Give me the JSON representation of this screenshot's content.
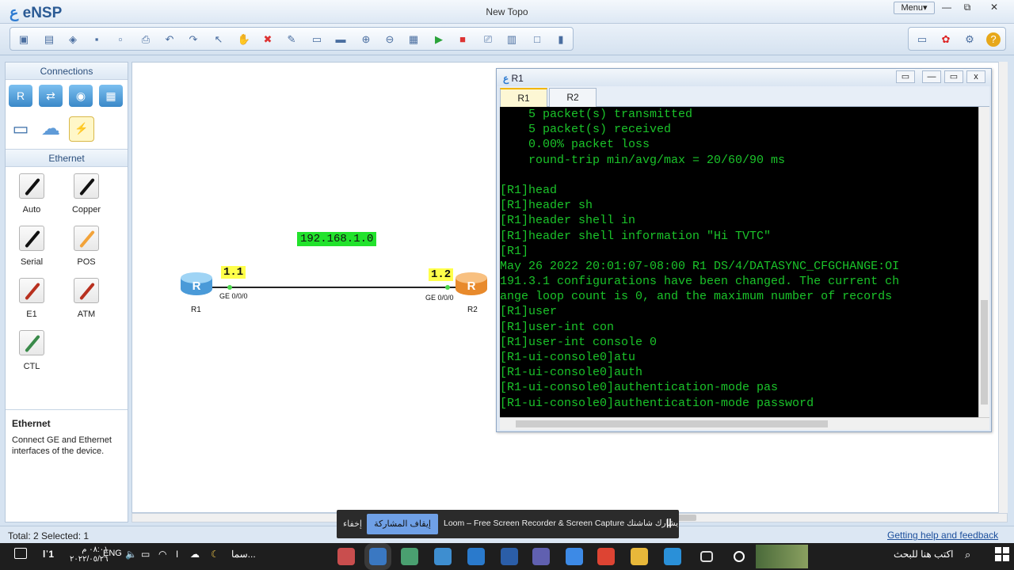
{
  "app": {
    "logo": "eNSP",
    "logo_mark": "ع",
    "window_title": "New Topo",
    "menu_label": "Menu▾",
    "min": "—",
    "restore": "⧉",
    "close": "✕"
  },
  "toolbar": {
    "icons": [
      "new-topo-icon",
      "new-project-icon",
      "open-icon",
      "save-icon",
      "save-as-icon",
      "print-icon",
      "undo-icon",
      "redo-icon",
      "select-icon",
      "pan-icon",
      "delete-icon",
      "delete-link-icon",
      "text-icon",
      "rectangle-icon",
      "zoom-in-icon",
      "zoom-out-icon",
      "topology-icon",
      "start-device-icon",
      "stop-device-icon",
      "capture-icon",
      "settings-grid-icon",
      "fullscreen-icon",
      "terminal-icon"
    ],
    "glyphs": [
      "▣",
      "▤",
      "◈",
      "▪",
      "▫",
      "⎙",
      "↶",
      "↷",
      "↖",
      "✋",
      "✖",
      "✎",
      "▭",
      "▬",
      "⊕",
      "⊖",
      "▦",
      "▶",
      "■",
      "⎚",
      "▥",
      "□",
      "▮"
    ],
    "right_icons": [
      "chat-icon",
      "huawei-logo-icon",
      "gear-icon",
      "help-icon"
    ],
    "right_glyphs": [
      "▭",
      "✿",
      "⚙",
      "?"
    ]
  },
  "left_panel": {
    "connections_title": "Connections",
    "ethernet_title": "Ethernet",
    "cables": [
      {
        "label": "Auto",
        "color": "#111111"
      },
      {
        "label": "Copper",
        "color": "#111111"
      },
      {
        "label": "Serial",
        "color": "#111111"
      },
      {
        "label": "POS",
        "color": "#f2a33a"
      },
      {
        "label": "E1",
        "color": "#b8301f"
      },
      {
        "label": "ATM",
        "color": "#b8301f"
      },
      {
        "label": "CTL",
        "color": "#3a8a4a"
      }
    ],
    "info_title": "Ethernet",
    "info_text": "Connect GE and Ethernet interfaces of the device."
  },
  "topology": {
    "network_label": "192.168.1.0",
    "r1": {
      "name": "R1",
      "ip": "1.1",
      "port": "GE 0/0/0",
      "color": "#6ab7ec"
    },
    "r2": {
      "name": "R2",
      "ip": "1.2",
      "port": "GE 0/0/0",
      "color": "#f5a04a"
    },
    "router_letter": "R"
  },
  "console": {
    "title": "R1",
    "tabs": [
      "R1",
      "R2"
    ],
    "restore": "▭",
    "min": "—",
    "max": "▭",
    "close": "x",
    "lines": [
      "    5 packet(s) transmitted",
      "    5 packet(s) received",
      "    0.00% packet loss",
      "    round-trip min/avg/max = 20/60/90 ms",
      "",
      "[R1]head",
      "[R1]header sh",
      "[R1]header shell in",
      "[R1]header shell information \"Hi TVTC\"",
      "[R1]",
      "May 26 2022 20:01:07-08:00 R1 DS/4/DATASYNC_CFGCHANGE:OI",
      "191.3.1 configurations have been changed. The current ch",
      "ange loop count is 0, and the maximum number of records",
      "[R1]user",
      "[R1]user-int con",
      "[R1]user-int console 0",
      "[R1-ui-console0]atu",
      "[R1-ui-console0]auth",
      "[R1-ui-console0]authentication-mode pas",
      "[R1-ui-console0]authentication-mode password"
    ]
  },
  "status": {
    "total": "Total: 2  Selected: 1",
    "help": "Getting help and feedback"
  },
  "loom": {
    "hide": "إخفاء",
    "stop": "إيقاف المشاركة",
    "message": "Loom – Free Screen Recorder & Screen Capture يشارك شاشتك.",
    "pause": "||"
  },
  "taskbar": {
    "time": "٠٨:٠١ م",
    "date": "٢٠٢٢/٠٥/٢٦",
    "lang": "ENG",
    "weather": "سما...",
    "search": "اكتب هنا للبحث",
    "sys_icons": [
      "volume-icon",
      "battery-icon",
      "wifi-icon",
      "microphone-icon",
      "onedrive-icon",
      "moon-icon"
    ],
    "sys_glyphs": [
      "🔈",
      "▭",
      "◠",
      "ǀ",
      "☁",
      "☾"
    ],
    "apps": [
      "ensp-app-icon",
      "ensp-active-app-icon",
      "network-app-icon",
      "store-app-icon",
      "vscode-app-icon",
      "word-app-icon",
      "teams-app-icon",
      "zoom-app-icon",
      "chrome-app-icon",
      "explorer-app-icon",
      "edge-app-icon",
      "taskview-icon",
      "cortana-icon"
    ],
    "app_colors": [
      "#c94e4e",
      "#3a78c2",
      "#4aa070",
      "#3e8ed0",
      "#2a7acc",
      "#2b5ea8",
      "#6060b0",
      "#3d8ae6",
      "#dd4433",
      "#e8b83a",
      "#2a90d8",
      "#888888",
      "#ffffff"
    ]
  }
}
